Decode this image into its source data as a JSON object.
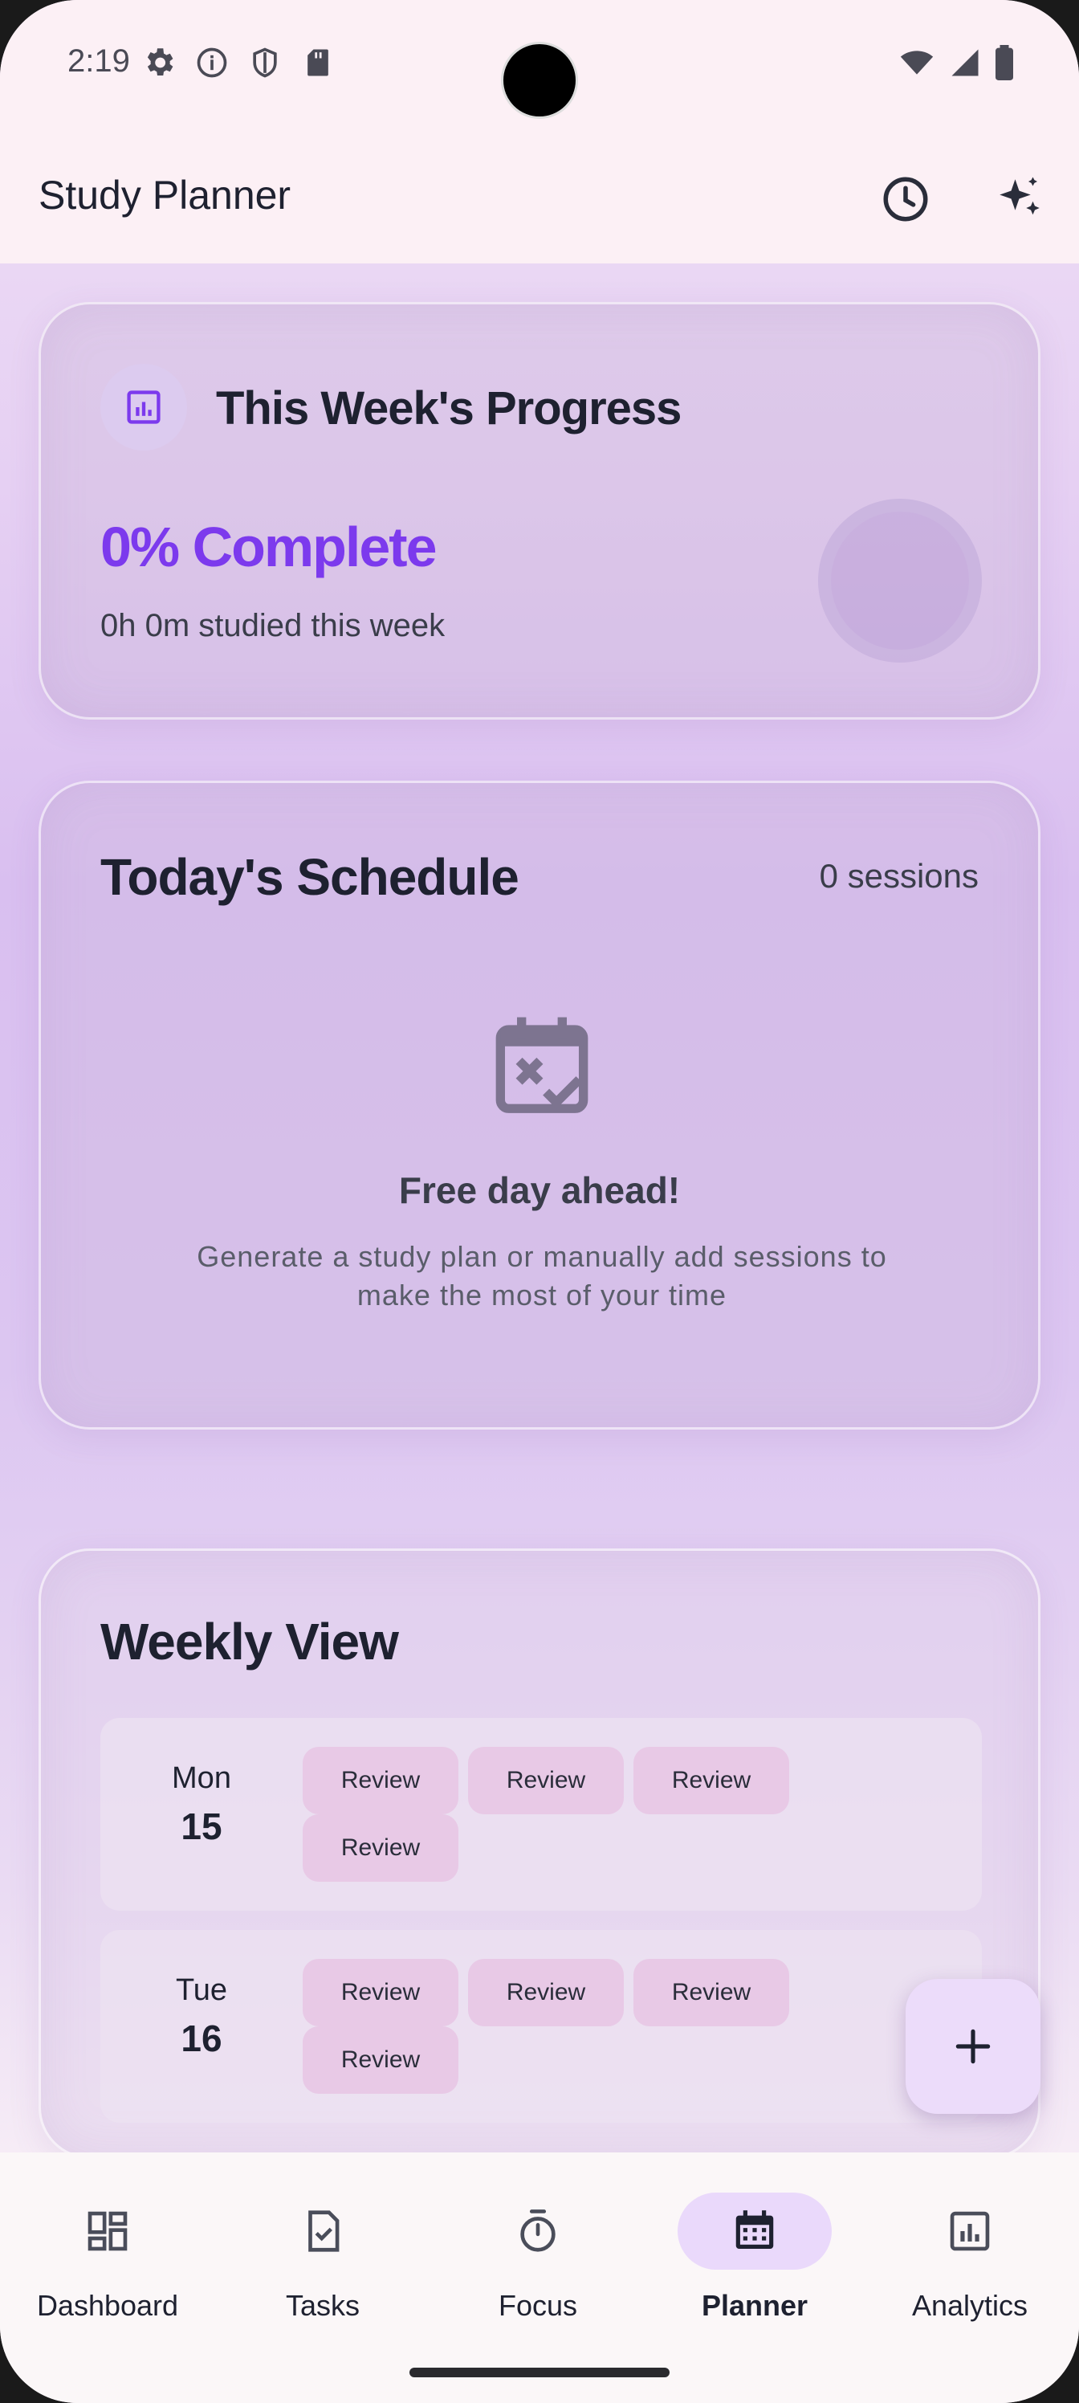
{
  "status_bar": {
    "time": "2:19",
    "icons": [
      "settings-icon",
      "info-icon",
      "shield-icon",
      "sd-card-icon"
    ],
    "right_icons": [
      "wifi-icon",
      "signal-icon",
      "battery-icon"
    ]
  },
  "app_bar": {
    "title": "Study Planner",
    "actions": [
      "history-icon",
      "sparkles-icon"
    ]
  },
  "progress": {
    "title": "This Week's Progress",
    "percent_label": "0% Complete",
    "studied_label": "0h 0m studied this week",
    "percent": 0
  },
  "schedule": {
    "title": "Today's Schedule",
    "count_label": "0 sessions",
    "empty_title": "Free day ahead!",
    "empty_desc": "Generate a study plan or manually add sessions to make the most of your time"
  },
  "weekly": {
    "title": "Weekly View",
    "days": [
      {
        "name": "Mon",
        "date": "15",
        "chips": [
          "Review",
          "Review",
          "Review",
          "Review"
        ]
      },
      {
        "name": "Tue",
        "date": "16",
        "chips": [
          "Review",
          "Review",
          "Review",
          "Review"
        ]
      }
    ]
  },
  "fab": {
    "icon": "plus-icon"
  },
  "nav": {
    "items": [
      {
        "label": "Dashboard",
        "icon": "dashboard-icon",
        "active": false
      },
      {
        "label": "Tasks",
        "icon": "tasks-icon",
        "active": false
      },
      {
        "label": "Focus",
        "icon": "timer-icon",
        "active": false
      },
      {
        "label": "Planner",
        "icon": "calendar-icon",
        "active": true
      },
      {
        "label": "Analytics",
        "icon": "analytics-icon",
        "active": false
      }
    ]
  },
  "colors": {
    "accent": "#7c3aed",
    "chip": "#e8c9e6",
    "nav_active": "#ead9fb",
    "text_dark": "#1e2130"
  }
}
